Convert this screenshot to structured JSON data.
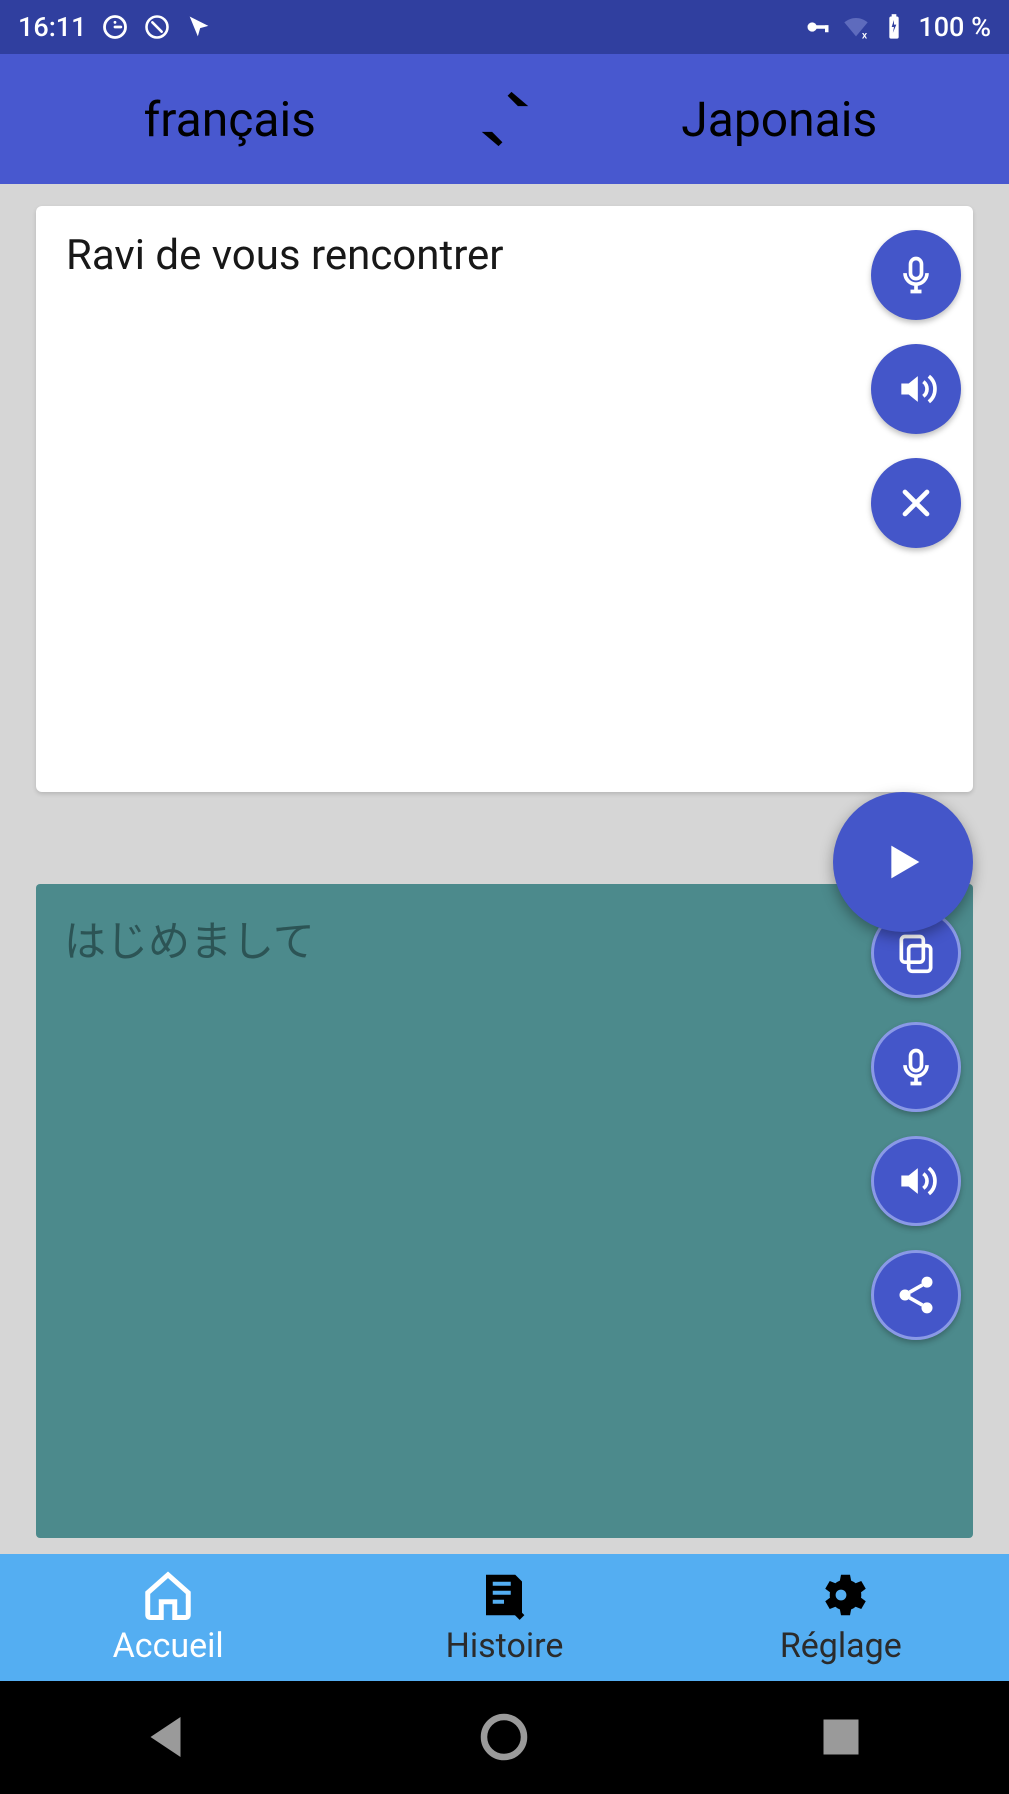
{
  "status": {
    "time": "16:11",
    "battery": "100 %"
  },
  "languages": {
    "source": "français",
    "target": "Japonais"
  },
  "input": {
    "text": "Ravi de vous rencontrer"
  },
  "output": {
    "text": "はじめまして"
  },
  "tabs": {
    "home": "Accueil",
    "history": "Histoire",
    "settings": "Réglage"
  },
  "colors": {
    "status_bar": "#303F9F",
    "lang_bar": "#4858cf",
    "button": "#4456c9",
    "output_card": "#4c8a8c",
    "bottom_bar": "#54aef2"
  }
}
